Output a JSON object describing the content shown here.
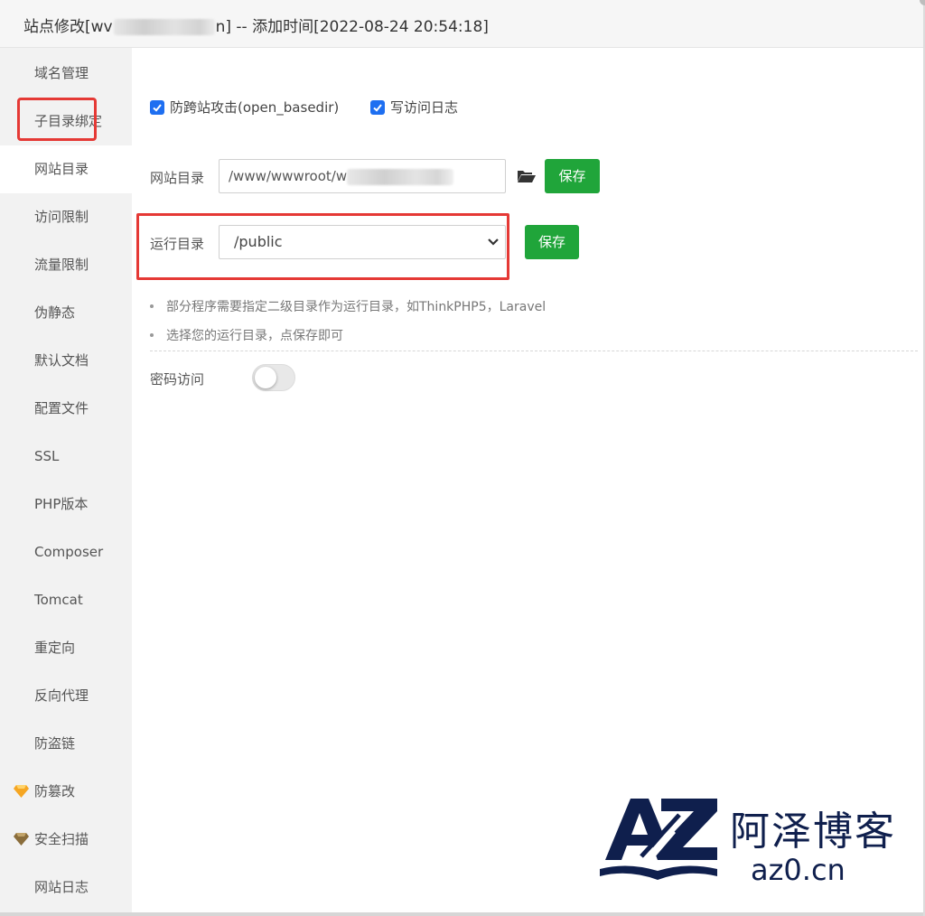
{
  "title": {
    "prefix": "站点修改[wv",
    "suffix": "n] -- 添加时间[2022-08-24 20:54:18]"
  },
  "sidebar": {
    "items": [
      {
        "label": "域名管理"
      },
      {
        "label": "子目录绑定"
      },
      {
        "label": "网站目录",
        "active": true
      },
      {
        "label": "访问限制"
      },
      {
        "label": "流量限制"
      },
      {
        "label": "伪静态"
      },
      {
        "label": "默认文档"
      },
      {
        "label": "配置文件"
      },
      {
        "label": "SSL"
      },
      {
        "label": "PHP版本"
      },
      {
        "label": "Composer"
      },
      {
        "label": "Tomcat"
      },
      {
        "label": "重定向"
      },
      {
        "label": "反向代理"
      },
      {
        "label": "防盗链"
      },
      {
        "label": "防篡改",
        "icon": "gem-icon"
      },
      {
        "label": "安全扫描",
        "icon": "gem-icon"
      },
      {
        "label": "网站日志"
      }
    ]
  },
  "options": {
    "anti_xss": {
      "label": "防跨站攻击(open_basedir)",
      "checked": true
    },
    "access_log": {
      "label": "写访问日志",
      "checked": true
    }
  },
  "site_dir": {
    "label": "网站目录",
    "value_prefix": "/www/wwwroot/w",
    "save_label": "保存"
  },
  "run_dir": {
    "label": "运行目录",
    "selected": "/public",
    "save_label": "保存"
  },
  "tips": [
    "部分程序需要指定二级目录作为运行目录，如ThinkPHP5，Laravel",
    "选择您的运行目录，点保存即可"
  ],
  "password_access": {
    "label": "密码访问",
    "enabled": false
  },
  "watermark": {
    "brand": "阿泽博客",
    "url": "az0.cn"
  },
  "colors": {
    "accent": "#20a53a",
    "highlight": "#e53935",
    "checkbox": "#1e6ff1",
    "sidebar_bg": "#f2f2f2"
  }
}
